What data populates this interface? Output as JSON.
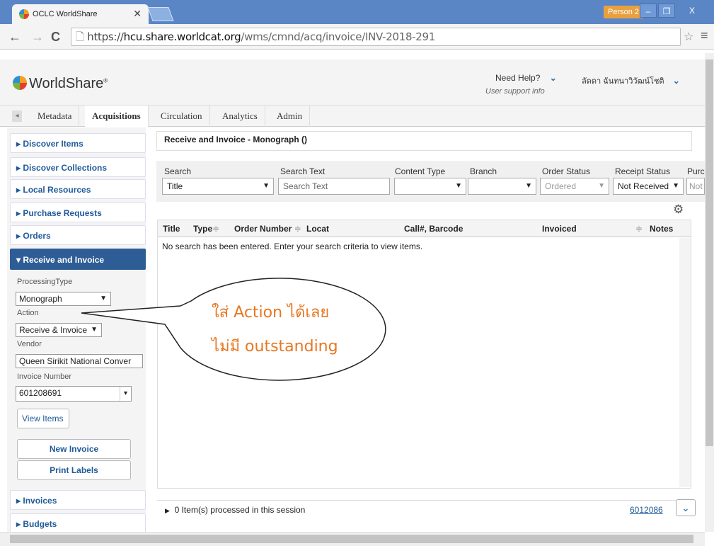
{
  "browser": {
    "tab_title": "OCLC WorldShare",
    "person": "Person 2",
    "url_scheme": "https://",
    "url_host": "hcu.share.worldcat.org",
    "url_path": "/wms/cmnd/acq/invoice/INV-2018-291"
  },
  "header": {
    "brand": "WorldShare",
    "need_help": "Need Help?",
    "user_support": "User support info",
    "user_name": "ลัดดา ฉันทนาวิวัฒน์โชติ"
  },
  "modules": [
    "Metadata",
    "Acquisitions",
    "Circulation",
    "Analytics",
    "Admin"
  ],
  "sidebar": {
    "items": [
      "Discover Items",
      "Discover Collections",
      "Local Resources",
      "Purchase Requests",
      "Orders",
      "Receive and Invoice"
    ],
    "processing_type_label": "ProcessingType",
    "processing_type_value": "Monograph",
    "action_label": "Action",
    "action_value": "Receive & Invoice",
    "vendor_label": "Vendor",
    "vendor_value": "Queen Sirikit National Conver",
    "invoice_number_label": "Invoice Number",
    "invoice_number_value": "601208691",
    "view_items": "View Items",
    "new_invoice": "New Invoice",
    "print_labels": "Print Labels",
    "bottom_items": [
      "Invoices",
      "Budgets"
    ]
  },
  "main": {
    "heading": "Receive and Invoice - Monograph ()",
    "filters": {
      "search_label": "Search",
      "search_value": "Title",
      "search_text_label": "Search Text",
      "search_text_placeholder": "Search Text",
      "content_type_label": "Content Type",
      "branch_label": "Branch",
      "order_status_label": "Order Status",
      "order_status_value": "Ordered",
      "receipt_status_label": "Receipt Status",
      "receipt_status_value": "Not Received",
      "purchase_label": "Purcl",
      "purchase_value": "Not"
    },
    "columns": [
      "Title",
      "Type",
      "Order Number",
      "Locat",
      "Call#, Barcode",
      "Invoiced",
      "Notes"
    ],
    "empty_message": "No search has been entered. Enter your search criteria to view items.",
    "processed": "0 Item(s) processed in this session",
    "invoice_link": "6012086"
  },
  "callout": {
    "line1": "ใส่ Action ได้เลย",
    "line2": "ไม่มี outstanding",
    "color": "#e87722"
  }
}
